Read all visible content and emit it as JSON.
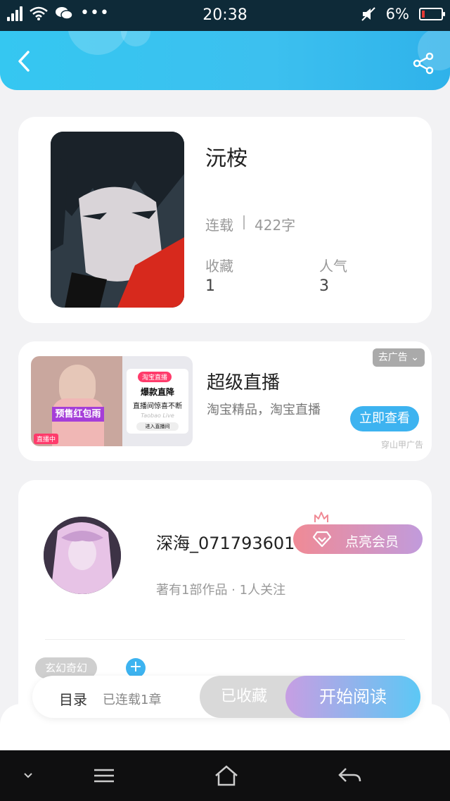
{
  "status_bar": {
    "time": "20:38",
    "battery": "6%",
    "icons": [
      "signal-icon",
      "wifi-icon",
      "wechat-icon",
      "more-dots-icon",
      "mute-icon",
      "battery-icon"
    ]
  },
  "header": {
    "icons": [
      "back-icon",
      "share-icon"
    ]
  },
  "book": {
    "title": "沅桉",
    "status": "连载",
    "word_count": "422字",
    "stats": [
      {
        "label": "收藏",
        "value": "1"
      },
      {
        "label": "人气",
        "value": "3"
      }
    ]
  },
  "ad": {
    "title": "超级直播",
    "description": "淘宝精品，淘宝直播",
    "tag": "去广告",
    "button": "立即查看",
    "note": "穿山甲广告",
    "image": {
      "live_badge": "淘宝直播",
      "headline": "爆款直降",
      "subline": "直播间惊喜不断",
      "slogan": "Taobao Live",
      "enter": "进入直播间",
      "promo": "预售红包雨",
      "live_tag": "直播中"
    }
  },
  "author": {
    "name": "深海_071793601",
    "summary": "著有1部作品 · 1人关注",
    "vip_button": "点亮会员",
    "genre": "玄幻奇幻",
    "add_tag": "+"
  },
  "action_bar": {
    "catalog": "目录",
    "catalog_info": "已连载1章",
    "collected": "已收藏",
    "start_reading": "开始阅读"
  },
  "colors": {
    "accent": "#3db3f0",
    "header": "#35c7f1",
    "vip_start": "#f08a95",
    "vip_end": "#c19bdc"
  },
  "nav": {
    "icons": [
      "collapse-icon",
      "menu-icon",
      "home-icon",
      "back-nav-icon"
    ]
  }
}
